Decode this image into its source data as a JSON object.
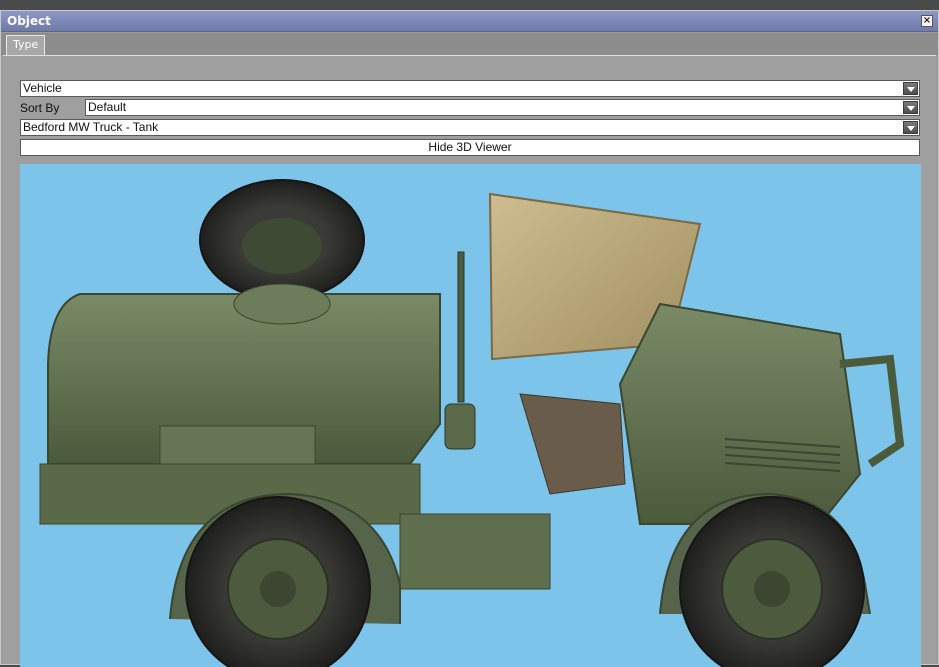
{
  "window": {
    "title": "Object",
    "close_glyph": "×"
  },
  "tabs": [
    {
      "label": "Type"
    }
  ],
  "category_select": {
    "value": "Vehicle"
  },
  "sort": {
    "label": "Sort By",
    "value": "Default"
  },
  "object_select": {
    "value": "Bedford MW Truck - Tank"
  },
  "viewer_toggle": {
    "label": "Hide 3D Viewer"
  },
  "colors": {
    "title_bar": "#7e88b8",
    "viewer_bg": "#7cc4ea",
    "truck_green": "#5e6e4a",
    "canvas_top": "#c9b98a"
  }
}
